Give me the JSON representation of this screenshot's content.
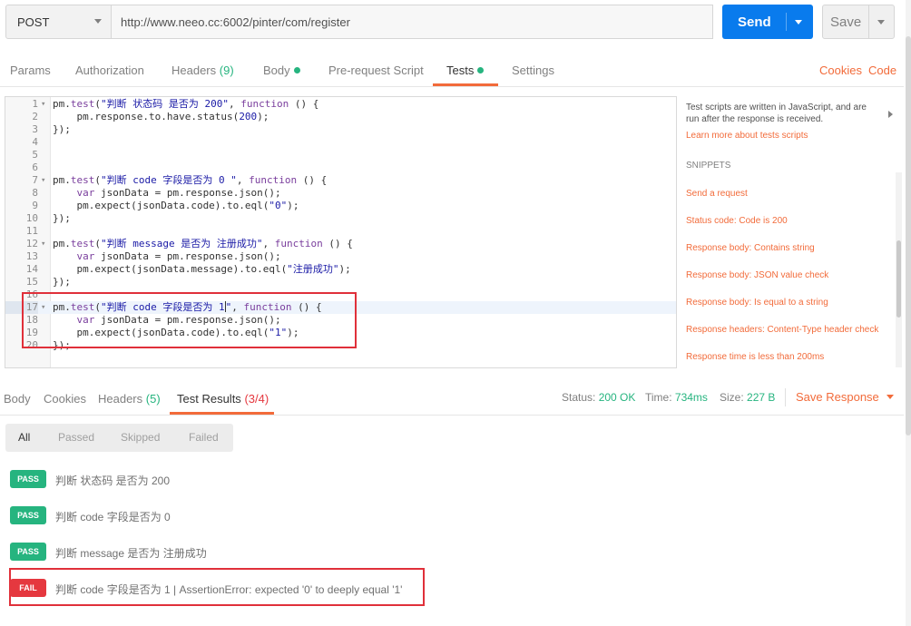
{
  "request": {
    "method": "POST",
    "url": "http://www.neeo.cc:6002/pinter/com/register",
    "send_label": "Send",
    "save_label": "Save"
  },
  "request_tabs": {
    "params": "Params",
    "authorization": "Authorization",
    "headers": "Headers",
    "headers_count": "(9)",
    "body": "Body",
    "pre_request": "Pre-request Script",
    "tests": "Tests",
    "settings": "Settings",
    "cookies": "Cookies",
    "code": "Code"
  },
  "editor": {
    "lines": [
      {
        "n": "1",
        "fold": "▾",
        "parts": [
          [
            "",
            "pm."
          ],
          [
            "kw",
            "test"
          ],
          [
            "",
            "("
          ],
          [
            "str",
            "\"判断 状态码 是否为 200\""
          ],
          [
            "",
            ", "
          ],
          [
            "kw",
            "function"
          ],
          [
            "",
            " () {"
          ]
        ]
      },
      {
        "n": "2",
        "fold": "",
        "parts": [
          [
            "",
            "    pm.response.to.have.status("
          ],
          [
            "num",
            "200"
          ],
          [
            "",
            ");"
          ]
        ]
      },
      {
        "n": "3",
        "fold": "",
        "parts": [
          [
            "",
            "});"
          ]
        ]
      },
      {
        "n": "4",
        "fold": "",
        "parts": []
      },
      {
        "n": "5",
        "fold": "",
        "parts": []
      },
      {
        "n": "6",
        "fold": "",
        "parts": []
      },
      {
        "n": "7",
        "fold": "▾",
        "parts": [
          [
            "",
            "pm."
          ],
          [
            "kw",
            "test"
          ],
          [
            "",
            "("
          ],
          [
            "str",
            "\"判断 code 字段是否为 0 \""
          ],
          [
            "",
            ", "
          ],
          [
            "kw",
            "function"
          ],
          [
            "",
            " () {"
          ]
        ]
      },
      {
        "n": "8",
        "fold": "",
        "parts": [
          [
            "",
            "    "
          ],
          [
            "kw",
            "var"
          ],
          [
            "",
            " jsonData = pm.response.json();"
          ]
        ]
      },
      {
        "n": "9",
        "fold": "",
        "parts": [
          [
            "",
            "    pm.expect(jsonData.code).to.eql("
          ],
          [
            "str",
            "\"0\""
          ],
          [
            "",
            ");"
          ]
        ]
      },
      {
        "n": "10",
        "fold": "",
        "parts": [
          [
            "",
            "});"
          ]
        ]
      },
      {
        "n": "11",
        "fold": "",
        "parts": []
      },
      {
        "n": "12",
        "fold": "▾",
        "parts": [
          [
            "",
            "pm."
          ],
          [
            "kw",
            "test"
          ],
          [
            "",
            "("
          ],
          [
            "str",
            "\"判断 message 是否为 注册成功\""
          ],
          [
            "",
            ", "
          ],
          [
            "kw",
            "function"
          ],
          [
            "",
            " () {"
          ]
        ]
      },
      {
        "n": "13",
        "fold": "",
        "parts": [
          [
            "",
            "    "
          ],
          [
            "kw",
            "var"
          ],
          [
            "",
            " jsonData = pm.response.json();"
          ]
        ]
      },
      {
        "n": "14",
        "fold": "",
        "parts": [
          [
            "",
            "    pm.expect(jsonData.message).to.eql("
          ],
          [
            "str",
            "\"注册成功\""
          ],
          [
            "",
            ");"
          ]
        ]
      },
      {
        "n": "15",
        "fold": "",
        "parts": [
          [
            "",
            "});"
          ]
        ]
      },
      {
        "n": "16",
        "fold": "",
        "parts": []
      },
      {
        "n": "17",
        "fold": "▾",
        "parts": [
          [
            "",
            "pm."
          ],
          [
            "kw",
            "test"
          ],
          [
            "",
            "("
          ],
          [
            "str",
            "\"判断 code 字段是否为 1"
          ],
          [
            "cursor",
            ""
          ],
          [
            "str",
            "\""
          ],
          [
            "",
            ", "
          ],
          [
            "kw",
            "function"
          ],
          [
            "",
            " () {"
          ]
        ]
      },
      {
        "n": "18",
        "fold": "",
        "parts": [
          [
            "",
            "    "
          ],
          [
            "kw",
            "var"
          ],
          [
            "",
            " jsonData = pm.response.json();"
          ]
        ]
      },
      {
        "n": "19",
        "fold": "",
        "parts": [
          [
            "",
            "    pm.expect(jsonData.code).to.eql("
          ],
          [
            "str",
            "\"1\""
          ],
          [
            "",
            ");"
          ]
        ]
      },
      {
        "n": "20",
        "fold": "",
        "parts": [
          [
            "",
            "});"
          ]
        ]
      }
    ]
  },
  "snippets_panel": {
    "intro": "Test scripts are written in JavaScript, and are run after the response is received.",
    "learn_more": "Learn more about tests scripts",
    "title": "SNIPPETS",
    "items": [
      "Send a request",
      "Status code: Code is 200",
      "Response body: Contains string",
      "Response body: JSON value check",
      "Response body: Is equal to a string",
      "Response headers: Content-Type header check",
      "Response time is less than 200ms"
    ]
  },
  "response_tabs": {
    "body": "Body",
    "cookies": "Cookies",
    "headers": "Headers",
    "headers_count": "(5)",
    "test_results": "Test Results",
    "test_results_count": "(3/4)"
  },
  "status": {
    "status_label": "Status:",
    "status_value": "200 OK",
    "time_label": "Time:",
    "time_value": "734ms",
    "size_label": "Size:",
    "size_value": "227 B",
    "save_response": "Save Response"
  },
  "filters": [
    "All",
    "Passed",
    "Skipped",
    "Failed"
  ],
  "results": [
    {
      "badge": "PASS",
      "type": "pass",
      "text": "判断 状态码 是否为 200"
    },
    {
      "badge": "PASS",
      "type": "pass",
      "text": "判断 code 字段是否为 0"
    },
    {
      "badge": "PASS",
      "type": "pass",
      "text": "判断 message 是否为 注册成功"
    },
    {
      "badge": "FAIL",
      "type": "fail",
      "text": "判断 code 字段是否为 1 | AssertionError: expected '0' to deeply equal '1'"
    }
  ],
  "colors": {
    "accent": "#f26b3a",
    "send": "#097bed",
    "pass": "#26b47f",
    "fail": "#e5383f",
    "annotation": "#e0303a"
  }
}
